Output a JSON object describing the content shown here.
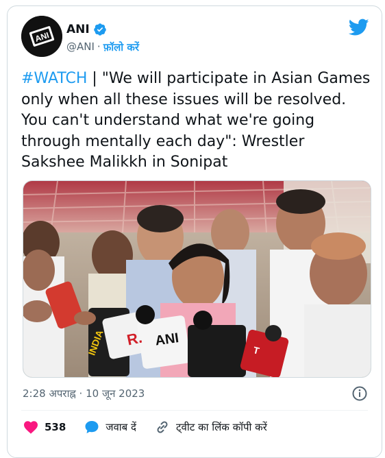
{
  "author": {
    "name": "ANI",
    "handle": "@ANI",
    "separator": "·",
    "follow_label": "फ़ॉलो करें",
    "verified_icon": "verified-badge-icon",
    "avatar_text": "ANI"
  },
  "tweet": {
    "hashtag": "#WATCH",
    "body": " | \"We will participate in Asian Games only when all these issues will be resolved. You can't understand what we're going through mentally each day\": Wrestler Sakshee Malikkh in Sonipat"
  },
  "media": {
    "mic_labels": [
      "ANI",
      "R.",
      "INDIA",
      "T"
    ]
  },
  "meta": {
    "timestamp": "2:28 अपराह्न · 10 जून 2023"
  },
  "actions": {
    "like_count": "538",
    "reply_label": "जवाब दें",
    "copy_link_label": "ट्वीट का लिंक कॉपी करें"
  },
  "colors": {
    "accent": "#1d9bf0",
    "like": "#f91880",
    "text": "#0f1419",
    "muted": "#536471"
  }
}
